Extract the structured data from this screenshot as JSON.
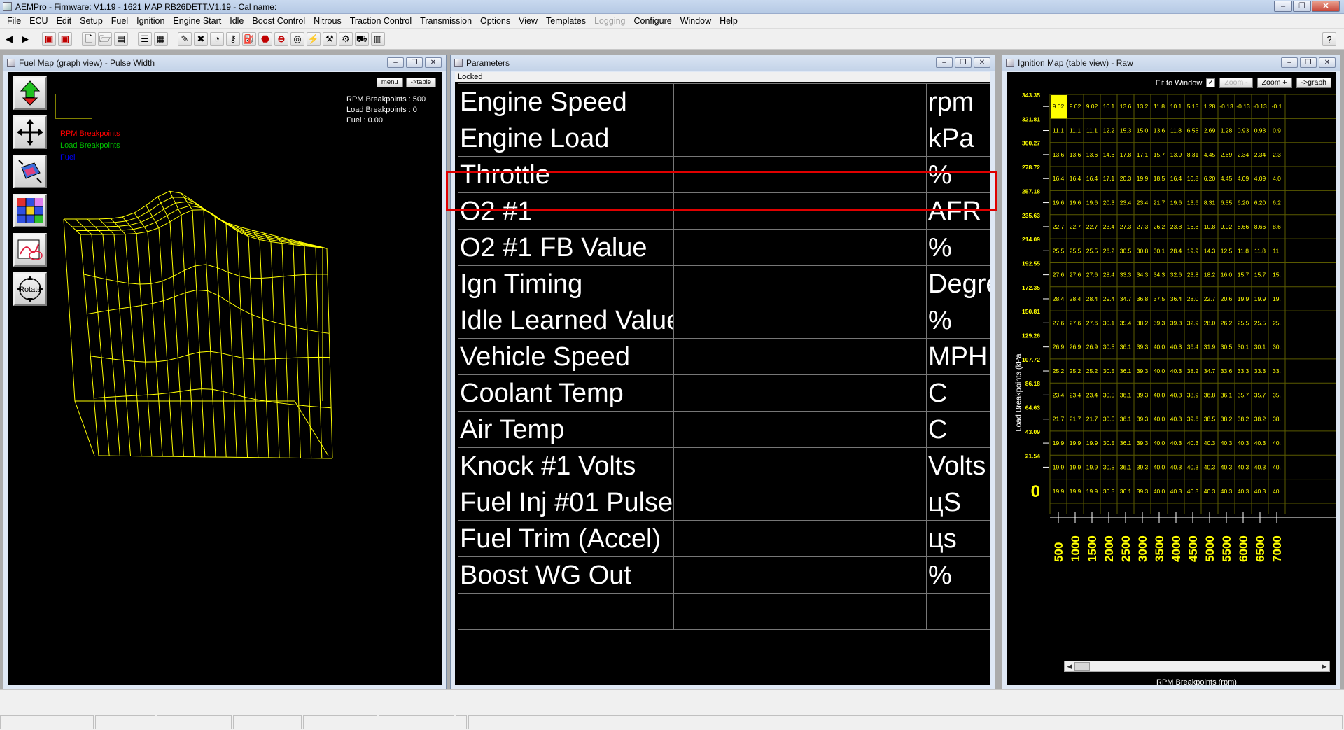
{
  "app": {
    "title": "AEMPro - Firmware: V1.19 - 1621 MAP RB26DETT.V1.19 - Cal name:",
    "window_buttons": {
      "minimize": "–",
      "restore": "❐",
      "close": "✕"
    }
  },
  "menu": [
    {
      "label": "File",
      "disabled": false
    },
    {
      "label": "ECU",
      "disabled": false
    },
    {
      "label": "Edit",
      "disabled": false
    },
    {
      "label": "Setup",
      "disabled": false
    },
    {
      "label": "Fuel",
      "disabled": false
    },
    {
      "label": "Ignition",
      "disabled": false
    },
    {
      "label": "Engine Start",
      "disabled": false
    },
    {
      "label": "Idle",
      "disabled": false
    },
    {
      "label": "Boost Control",
      "disabled": false
    },
    {
      "label": "Nitrous",
      "disabled": false
    },
    {
      "label": "Traction Control",
      "disabled": false
    },
    {
      "label": "Transmission",
      "disabled": false
    },
    {
      "label": "Options",
      "disabled": false
    },
    {
      "label": "View",
      "disabled": false
    },
    {
      "label": "Templates",
      "disabled": false
    },
    {
      "label": "Logging",
      "disabled": true
    },
    {
      "label": "Configure",
      "disabled": false
    },
    {
      "label": "Window",
      "disabled": false
    },
    {
      "label": "Help",
      "disabled": false
    }
  ],
  "toolbar": {
    "help_icon": "?"
  },
  "fuel_window": {
    "title": "Fuel Map (graph view) - Pulse Width",
    "menu_button": "menu",
    "table_button": "->table",
    "rpm_breakpoints": "RPM Breakpoints : 500",
    "load_breakpoints": "Load Breakpoints : 0",
    "fuel_value": "Fuel : 0.00",
    "legend": {
      "rpm": "RPM Breakpoints",
      "load": "Load Breakpoints",
      "fuel": "Fuel"
    },
    "tools": [
      "move-up-down",
      "pan",
      "zoom-3d",
      "color-grid",
      "trace-map",
      "rotate"
    ],
    "rotate_label": "Rotate",
    "colors": {
      "mesh": "#ffff00",
      "rpm": "#ff0000",
      "load": "#00c000",
      "fuel": "#0000ff"
    }
  },
  "param_window": {
    "title": "Parameters",
    "locked": "Locked",
    "rows": [
      {
        "name": "Engine Speed",
        "value": "",
        "unit": "rpm"
      },
      {
        "name": "Engine Load",
        "value": "",
        "unit": "kPa"
      },
      {
        "name": "Throttle",
        "value": "",
        "unit": "%"
      },
      {
        "name": "O2 #1",
        "value": "",
        "unit": "AFR"
      },
      {
        "name": "O2 #1 FB Value",
        "value": "",
        "unit": "%"
      },
      {
        "name": "Ign Timing",
        "value": "",
        "unit": "Degre"
      },
      {
        "name": "Idle Learned Value",
        "value": "",
        "unit": "%"
      },
      {
        "name": "Vehicle Speed",
        "value": "",
        "unit": "MPH"
      },
      {
        "name": "Coolant Temp",
        "value": "",
        "unit": "C"
      },
      {
        "name": "Air Temp",
        "value": "",
        "unit": "C"
      },
      {
        "name": "Knock #1 Volts",
        "value": "",
        "unit": "Volts"
      },
      {
        "name": "Fuel Inj #01 Pulse",
        "value": "",
        "unit": "цS"
      },
      {
        "name": "Fuel Trim (Accel)",
        "value": "",
        "unit": "цs"
      },
      {
        "name": "Boost WG Out",
        "value": "",
        "unit": "%"
      },
      {
        "name": "",
        "value": "",
        "unit": ""
      }
    ],
    "highlight_color": "#e00000"
  },
  "ign_window": {
    "title": "Ignition Map (table view) - Raw",
    "fit_label": "Fit to Window",
    "fit_checked": "✓",
    "zoom_minus": "Zoom -",
    "zoom_plus": "Zoom +",
    "graph_button": "->graph",
    "load_axis_label": "Load Breakpoints (kPa",
    "rpm_axis_label": "RPM Breakpoints (rpm)",
    "load_breakpoints": [
      "343.35",
      "321.81",
      "300.27",
      "278.72",
      "257.18",
      "235.63",
      "214.09",
      "192.55",
      "172.35",
      "150.81",
      "129.26",
      "107.72",
      "86.18",
      "64.63",
      "43.09",
      "21.54",
      "0"
    ],
    "rpm_breakpoints": [
      "500",
      "1000",
      "1500",
      "2000",
      "2500",
      "3000",
      "3500",
      "4000",
      "4500",
      "5000",
      "5500",
      "6000",
      "6500",
      "7000"
    ],
    "cells": [
      [
        "9.02",
        "9.02",
        "9.02",
        "10.1",
        "13.6",
        "13.2",
        "11.8",
        "10.1",
        "5.15",
        "1.28",
        "-0.13",
        "-0.13",
        "-0.13",
        "-0.1"
      ],
      [
        "11.1",
        "11.1",
        "11.1",
        "12.2",
        "15.3",
        "15.0",
        "13.6",
        "11.8",
        "6.55",
        "2.69",
        "1.28",
        "0.93",
        "0.93",
        "0.9"
      ],
      [
        "13.6",
        "13.6",
        "13.6",
        "14.6",
        "17.8",
        "17.1",
        "15.7",
        "13.9",
        "8.31",
        "4.45",
        "2.69",
        "2.34",
        "2.34",
        "2.3"
      ],
      [
        "16.4",
        "16.4",
        "16.4",
        "17.1",
        "20.3",
        "19.9",
        "18.5",
        "16.4",
        "10.8",
        "6.20",
        "4.45",
        "4.09",
        "4.09",
        "4.0"
      ],
      [
        "19.6",
        "19.6",
        "19.6",
        "20.3",
        "23.4",
        "23.4",
        "21.7",
        "19.6",
        "13.6",
        "8.31",
        "6.55",
        "6.20",
        "6.20",
        "6.2"
      ],
      [
        "22.7",
        "22.7",
        "22.7",
        "23.4",
        "27.3",
        "27.3",
        "26.2",
        "23.8",
        "16.8",
        "10.8",
        "9.02",
        "8.66",
        "8.66",
        "8.6"
      ],
      [
        "25.5",
        "25.5",
        "25.5",
        "26.2",
        "30.5",
        "30.8",
        "30.1",
        "28.4",
        "19.9",
        "14.3",
        "12.5",
        "11.8",
        "11.8",
        "11."
      ],
      [
        "27.6",
        "27.6",
        "27.6",
        "28.4",
        "33.3",
        "34.3",
        "34.3",
        "32.6",
        "23.8",
        "18.2",
        "16.0",
        "15.7",
        "15.7",
        "15."
      ],
      [
        "28.4",
        "28.4",
        "28.4",
        "29.4",
        "34.7",
        "36.8",
        "37.5",
        "36.4",
        "28.0",
        "22.7",
        "20.6",
        "19.9",
        "19.9",
        "19."
      ],
      [
        "27.6",
        "27.6",
        "27.6",
        "30.1",
        "35.4",
        "38.2",
        "39.3",
        "39.3",
        "32.9",
        "28.0",
        "26.2",
        "25.5",
        "25.5",
        "25."
      ],
      [
        "26.9",
        "26.9",
        "26.9",
        "30.5",
        "36.1",
        "39.3",
        "40.0",
        "40.3",
        "36.4",
        "31.9",
        "30.5",
        "30.1",
        "30.1",
        "30."
      ],
      [
        "25.2",
        "25.2",
        "25.2",
        "30.5",
        "36.1",
        "39.3",
        "40.0",
        "40.3",
        "38.2",
        "34.7",
        "33.6",
        "33.3",
        "33.3",
        "33."
      ],
      [
        "23.4",
        "23.4",
        "23.4",
        "30.5",
        "36.1",
        "39.3",
        "40.0",
        "40.3",
        "38.9",
        "36.8",
        "36.1",
        "35.7",
        "35.7",
        "35."
      ],
      [
        "21.7",
        "21.7",
        "21.7",
        "30.5",
        "36.1",
        "39.3",
        "40.0",
        "40.3",
        "39.6",
        "38.5",
        "38.2",
        "38.2",
        "38.2",
        "38."
      ],
      [
        "19.9",
        "19.9",
        "19.9",
        "30.5",
        "36.1",
        "39.3",
        "40.0",
        "40.3",
        "40.3",
        "40.3",
        "40.3",
        "40.3",
        "40.3",
        "40."
      ],
      [
        "19.9",
        "19.9",
        "19.9",
        "30.5",
        "36.1",
        "39.3",
        "40.0",
        "40.3",
        "40.3",
        "40.3",
        "40.3",
        "40.3",
        "40.3",
        "40."
      ],
      [
        "19.9",
        "19.9",
        "19.9",
        "30.5",
        "36.1",
        "39.3",
        "40.0",
        "40.3",
        "40.3",
        "40.3",
        "40.3",
        "40.3",
        "40.3",
        "40."
      ]
    ],
    "colors": {
      "text": "#ffff00",
      "grid": "#5a5a00",
      "selected": "#ffff00"
    }
  }
}
